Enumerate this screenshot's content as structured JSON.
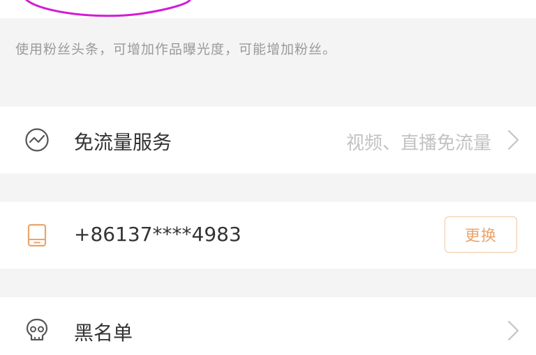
{
  "hint": {
    "text": "使用粉丝头条，可增加作品曝光度，可能增加粉丝。"
  },
  "traffic_free": {
    "icon": "traffic-service-icon",
    "title": "免流量服务",
    "subtitle": "视频、直播免流量"
  },
  "phone": {
    "icon": "phone-icon",
    "number": "+86137****4983",
    "change_label": "更换"
  },
  "blacklist": {
    "icon": "skull-icon",
    "title": "黑名单"
  },
  "colors": {
    "annotation": "#d21bd6",
    "accent": "#e9a46a",
    "icon_gray": "#555555"
  }
}
